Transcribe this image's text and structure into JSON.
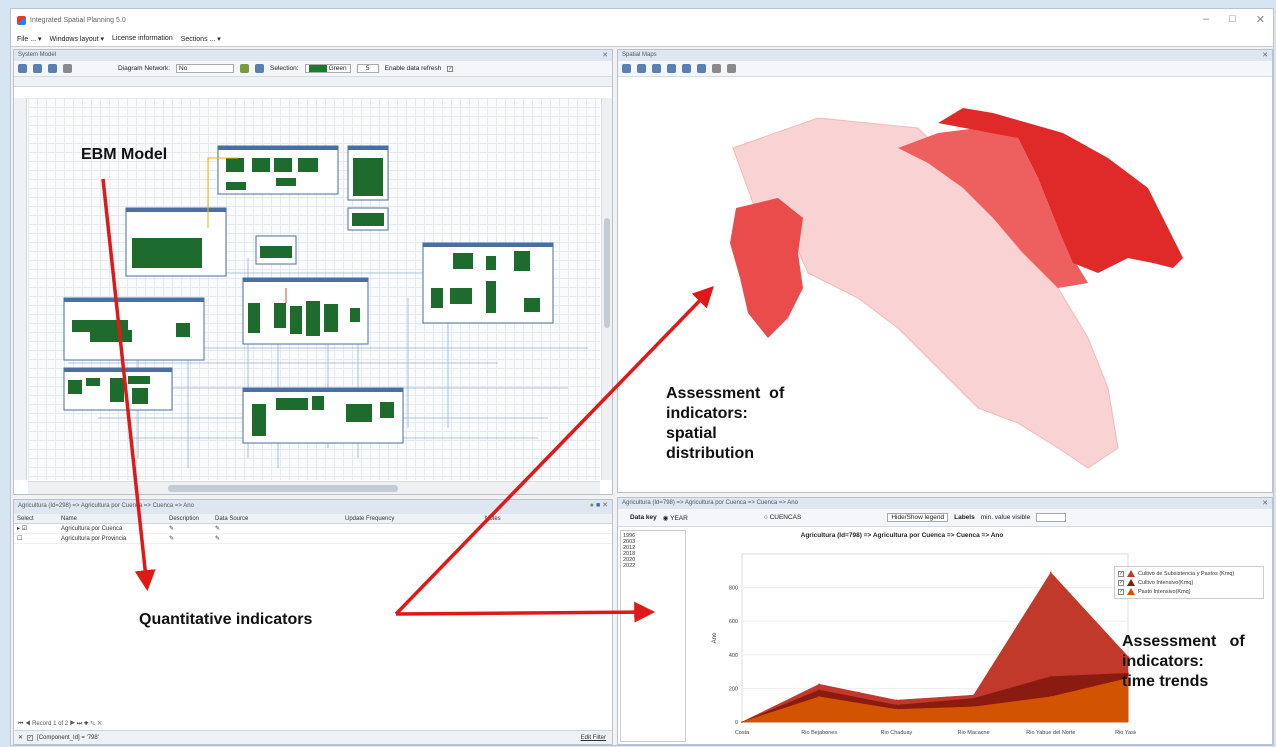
{
  "window": {
    "title": "Integrated Spatial Planning 5.0",
    "minimize": "–",
    "maximize": "□",
    "close": "✕"
  },
  "menu": [
    "File ... ▾",
    "Windows layout ▾",
    "License information",
    "Sections ... ▾"
  ],
  "system_model": {
    "title": "System Model",
    "diagram_network_label": "Diagram Network:",
    "diagram_network_value": "No",
    "selection_label": "Selection:",
    "selection_color": "Green",
    "count_value": "5",
    "enable_refresh_label": "Enable data refresh",
    "annotation": "EBM Model"
  },
  "spatial_maps": {
    "title": "Spatial Maps",
    "annotation": [
      "Assessment",
      "of",
      "indicators:",
      "spatial",
      "distribution"
    ]
  },
  "indicators_panel": {
    "title": "Agricultura (Id=298) => Agricultura por Cuenca => Cuenca => Ano",
    "columns": [
      "Select",
      "Name",
      "Description",
      "Data Source",
      "Update Frequency",
      "Notes"
    ],
    "rows": [
      {
        "marker": "▸",
        "checked": "☑",
        "name": "Agricultura por Cuenca"
      },
      {
        "marker": "",
        "checked": "☐",
        "name": "Agricultura por Provincia"
      }
    ],
    "record_nav": "Record 1 of 2",
    "filter_text": "[Component_Id] = '798'",
    "edit_filter": "Edit Filter",
    "annotation": "Quantitative indicators"
  },
  "trends_panel": {
    "title": "Agricultura (Id=798) => Agricultura por Cuenca => Cuenca => Ano",
    "data_key_label": "Data key",
    "year_label": "YEAR",
    "cuencas_label": "CUENCAS",
    "hide_show_legend": "Hide/Show legend",
    "labels_label": "Labels",
    "min_value_label": "min. value visible",
    "years": [
      "1996",
      "2003",
      "2012",
      "2018",
      "2020",
      "2022"
    ],
    "annotation": [
      "Assessment",
      "of",
      "indicators:",
      "time trends"
    ]
  },
  "chart_data": {
    "type": "area",
    "title": "Agricultura (Id=798) => Agricultura por Cuenca => Cuenca => Ano",
    "ylabel": "Ano",
    "xlabel": "",
    "categories": [
      "Costa",
      "Rio Bejabones",
      "Rio Chaduay",
      "Rio Macacne",
      "Rio Yabue del Norte",
      "Rio Yasica"
    ],
    "yticks": [
      0,
      200,
      400,
      600,
      800
    ],
    "ylim": [
      0,
      1000
    ],
    "series": [
      {
        "name": "Cultivo de Subsistencia y Pastos (Kmq)",
        "color": "#c0392b",
        "values": [
          0,
          225,
          130,
          160,
          890,
          390
        ]
      },
      {
        "name": "Cultivo Intensivo(Kmq)",
        "color": "#8b1a10",
        "values": [
          0,
          190,
          100,
          140,
          270,
          290
        ]
      },
      {
        "name": "Pasto Intensivo(Kmq)",
        "color": "#d35400",
        "values": [
          0,
          150,
          75,
          90,
          150,
          260
        ]
      }
    ],
    "legend_position": "top-right"
  }
}
